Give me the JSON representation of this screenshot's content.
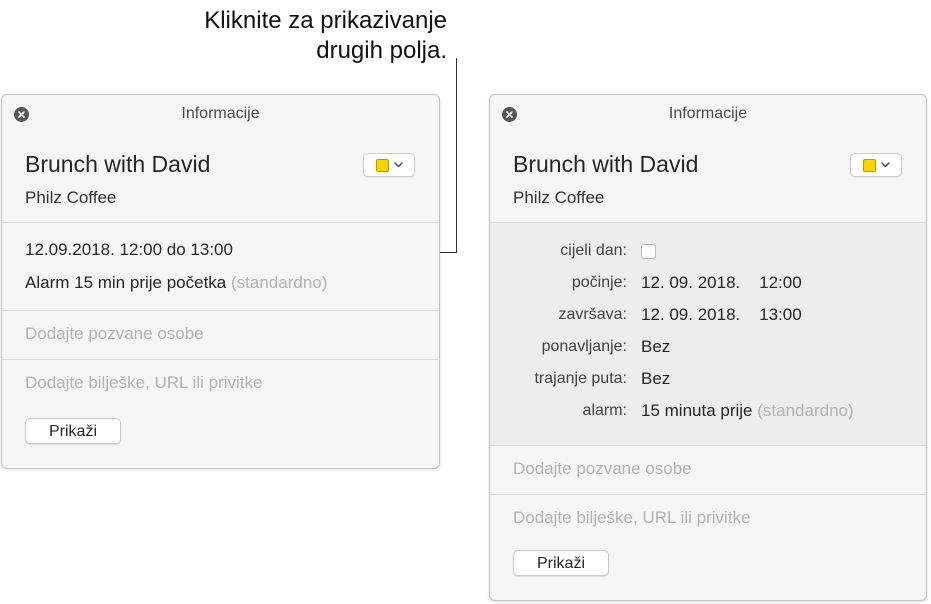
{
  "callout": {
    "line1": "Kliknite za prikazivanje",
    "line2": "drugih polja."
  },
  "left_panel": {
    "title": "Informacije",
    "event_title": "Brunch with David",
    "location": "Philz Coffee",
    "date_time": "12.09.2018. 12:00 do 13:00",
    "alarm": "Alarm 15 min prije početka",
    "alarm_default": "(standardno)",
    "invitees_placeholder": "Dodajte pozvane osobe",
    "notes_placeholder": "Dodajte bilješke, URL ili privitke",
    "show_button": "Prikaži"
  },
  "right_panel": {
    "title": "Informacije",
    "event_title": "Brunch with David",
    "location": "Philz Coffee",
    "all_day_label": "cijeli dan:",
    "all_day_checked": false,
    "starts_label": "počinje:",
    "starts_value": "12. 09. 2018.    12:00",
    "ends_label": "završava:",
    "ends_value": "12. 09. 2018.    13:00",
    "repeat_label": "ponavljanje:",
    "repeat_value": "Bez",
    "travel_label": "trajanje puta:",
    "travel_value": "Bez",
    "alarm_label": "alarm:",
    "alarm_value": "15 minuta prije",
    "alarm_default": "(standardno)",
    "invitees_placeholder": "Dodajte pozvane osobe",
    "notes_placeholder": "Dodajte bilješke, URL ili privitke",
    "show_button": "Prikaži"
  },
  "colors": {
    "calendar_color": "#f5d400",
    "panel_background": "#f6f6f6",
    "details_background": "#ededed",
    "placeholder_text": "#b3b3b3"
  },
  "icons": {
    "close": "close-icon",
    "chevron": "chevron-down-icon"
  }
}
